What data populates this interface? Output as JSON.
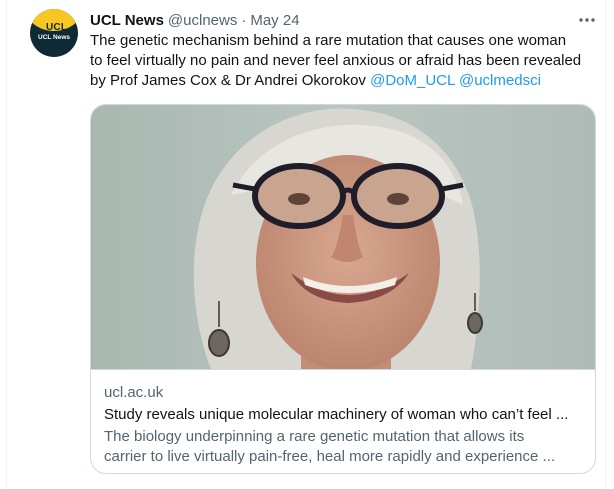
{
  "tweet": {
    "author_name": "UCL News",
    "handle": "@uclnews",
    "separator": "·",
    "date": "May 24",
    "text_lines": [
      "The genetic mechanism behind a rare mutation that causes one woman",
      "to feel virtually no pain and never feel anxious or afraid has been revealed",
      "by Prof James Cox & Dr Andrei Okorokov"
    ],
    "mention_1": "@DoM_UCL",
    "mention_2": "@uclmedsci",
    "accent_color": "#1d9bf0"
  },
  "avatar": {
    "logo_text_top": "UCL",
    "logo_text_bottom": "UCL News",
    "colors": {
      "gold": "#f7c623",
      "dark": "#0e2a36"
    }
  },
  "menu": {
    "icon": "more-horizontal-icon"
  },
  "card": {
    "domain": "ucl.ac.uk",
    "title": "Study reveals unique molecular machinery of woman who can’t feel ...",
    "description_lines": [
      "The biology underpinning a rare genetic mutation that allows its",
      "carrier to live virtually pain-free, heal more rapidly and experience ..."
    ]
  }
}
